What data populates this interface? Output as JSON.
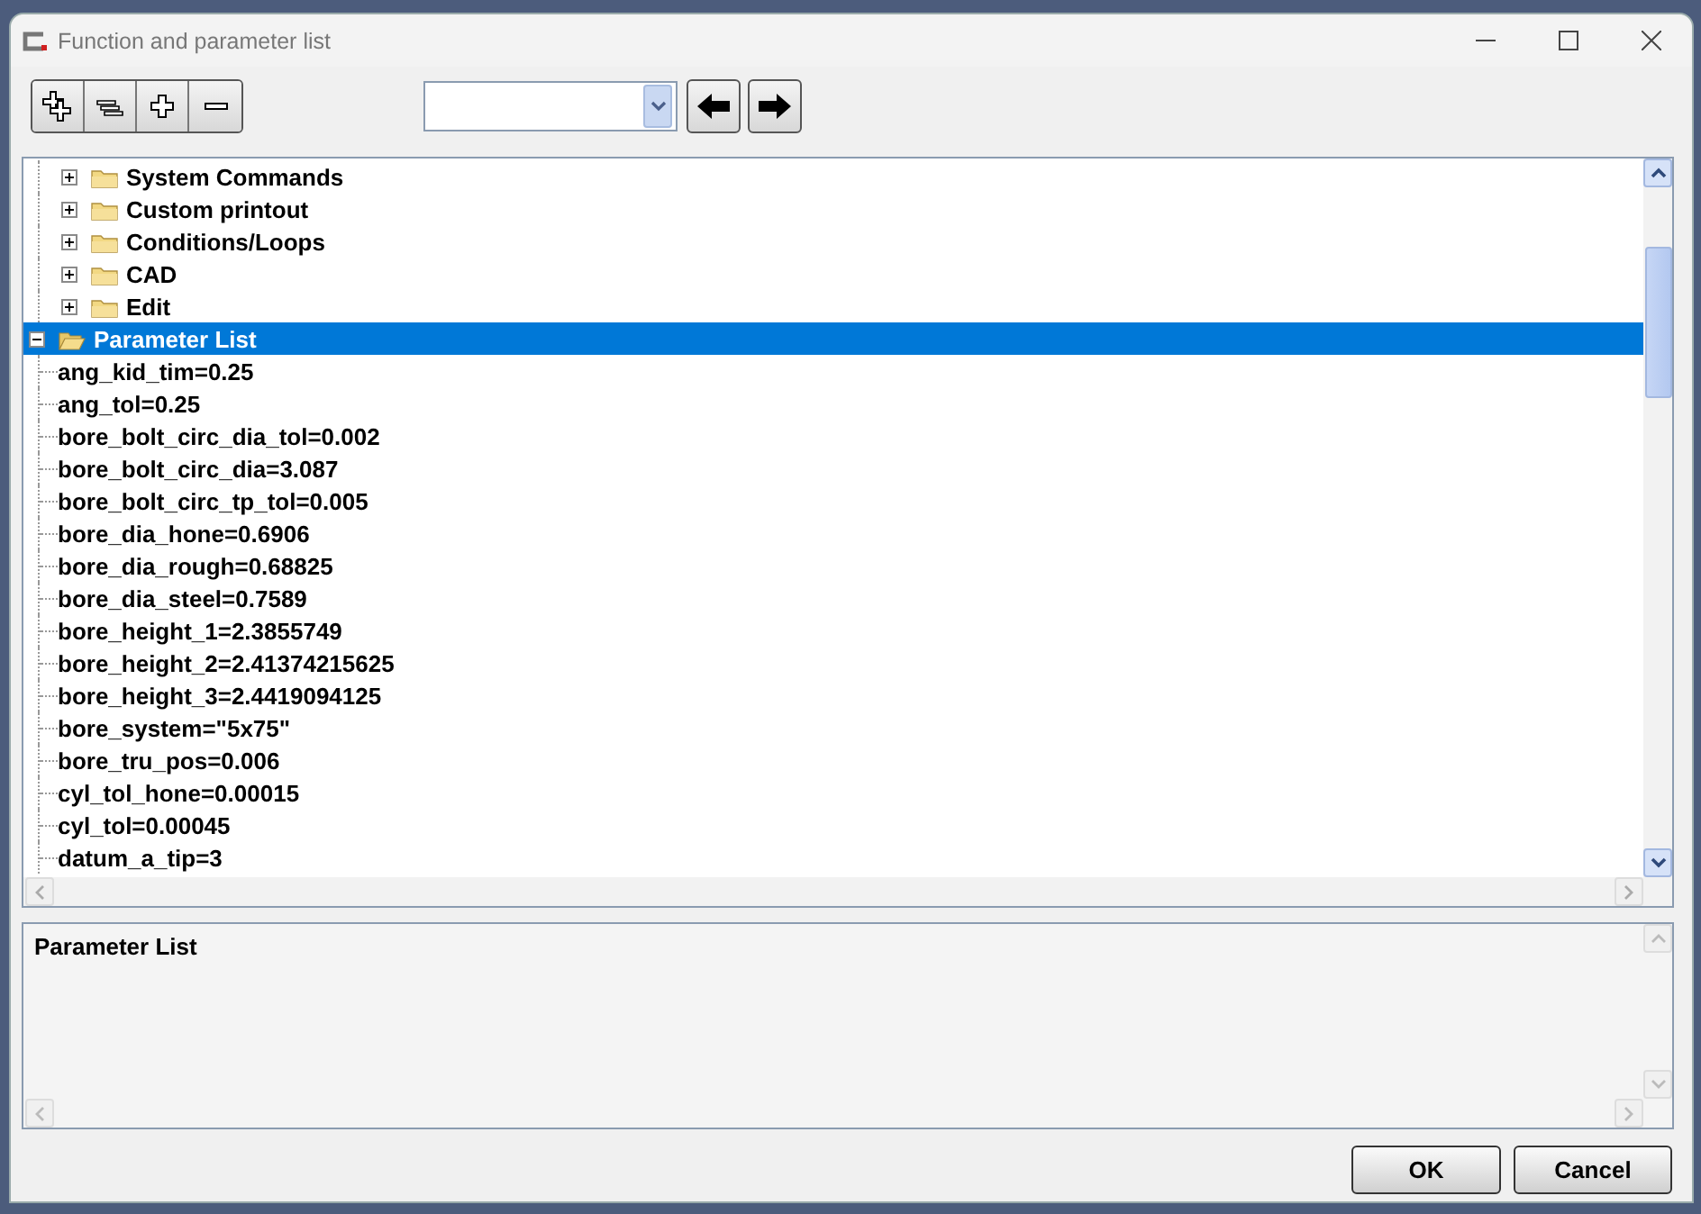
{
  "window": {
    "title": "Function and parameter list"
  },
  "tree": {
    "branch_children": [
      {
        "label": "System Commands",
        "kind": "folder",
        "expanded": false,
        "selected": false
      },
      {
        "label": "Custom printout",
        "kind": "folder",
        "expanded": false,
        "selected": false
      },
      {
        "label": "Conditions/Loops",
        "kind": "folder",
        "expanded": false,
        "selected": false
      },
      {
        "label": "CAD",
        "kind": "folder",
        "expanded": false,
        "selected": false
      },
      {
        "label": "Edit",
        "kind": "folder",
        "expanded": false,
        "selected": false
      }
    ],
    "items": [
      {
        "label": "Parameter List",
        "kind": "folder",
        "expanded": true,
        "selected": true,
        "children": [
          {
            "label": "ang_kid_tim=0.25",
            "kind": "param",
            "selected": false
          },
          {
            "label": "ang_tol=0.25",
            "kind": "param",
            "selected": false
          },
          {
            "label": "bore_bolt_circ_dia_tol=0.002",
            "kind": "param",
            "selected": false
          },
          {
            "label": "bore_bolt_circ_dia=3.087",
            "kind": "param",
            "selected": false
          },
          {
            "label": "bore_bolt_circ_tp_tol=0.005",
            "kind": "param",
            "selected": false
          },
          {
            "label": "bore_dia_hone=0.6906",
            "kind": "param",
            "selected": false
          },
          {
            "label": "bore_dia_rough=0.68825",
            "kind": "param",
            "selected": false
          },
          {
            "label": "bore_dia_steel=0.7589",
            "kind": "param",
            "selected": false
          },
          {
            "label": "bore_height_1=2.3855749",
            "kind": "param",
            "selected": false
          },
          {
            "label": "bore_height_2=2.41374215625",
            "kind": "param",
            "selected": false
          },
          {
            "label": "bore_height_3=2.4419094125",
            "kind": "param",
            "selected": false
          },
          {
            "label": "bore_system=\"5x75\"",
            "kind": "param",
            "selected": false
          },
          {
            "label": "bore_tru_pos=0.006",
            "kind": "param",
            "selected": false
          },
          {
            "label": "cyl_tol_hone=0.00015",
            "kind": "param",
            "selected": false
          },
          {
            "label": "cyl_tol=0.00045",
            "kind": "param",
            "selected": false
          },
          {
            "label": "datum_a_tip=3",
            "kind": "param",
            "selected": false
          }
        ]
      }
    ]
  },
  "description": {
    "text": "Parameter List"
  },
  "buttons": [
    "OK",
    "Cancel"
  ]
}
